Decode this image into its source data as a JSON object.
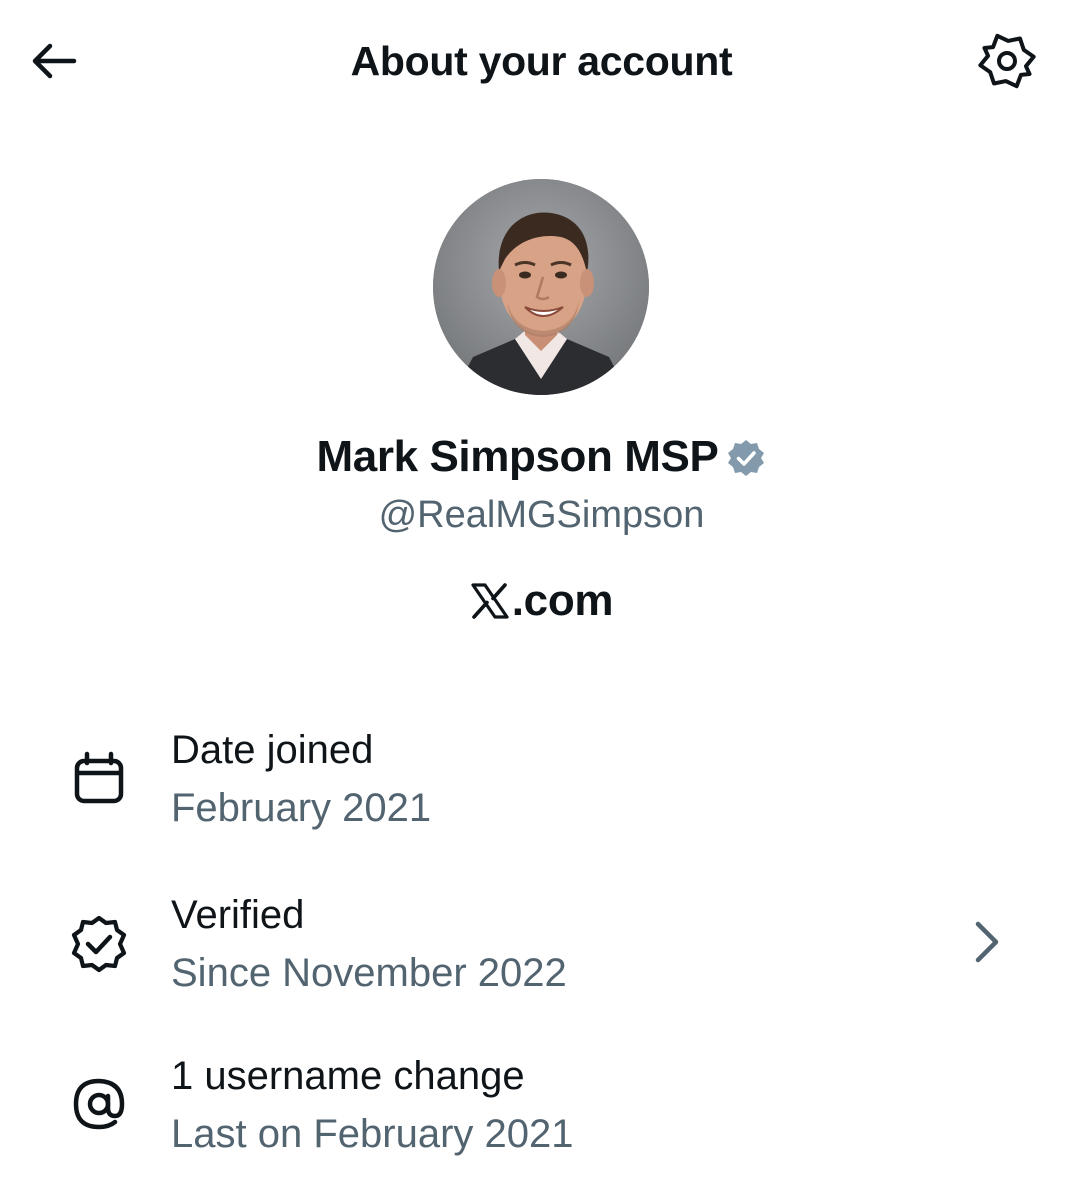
{
  "header": {
    "title": "About your account",
    "back_icon": "arrow-left-icon",
    "settings_icon": "gear-icon"
  },
  "profile": {
    "display_name": "Mark Simpson MSP",
    "handle": "@RealMGSimpson",
    "verified_badge_color": "#829aab",
    "avatar_icon": "profile-photo",
    "source_text": ".com",
    "source_logo": "x-logo-icon"
  },
  "rows": [
    {
      "icon": "calendar-icon",
      "title": "Date joined",
      "subtitle": "February 2021"
    },
    {
      "icon": "verified-check-icon",
      "title": "Verified",
      "subtitle": "Since November 2022",
      "chevron": "chevron-right-icon"
    },
    {
      "icon": "at-sign-icon",
      "title": "1 username change",
      "subtitle": "Last on February 2021"
    }
  ],
  "colors": {
    "text_primary": "#0f1419",
    "text_secondary": "#536471",
    "background": "#ffffff"
  }
}
